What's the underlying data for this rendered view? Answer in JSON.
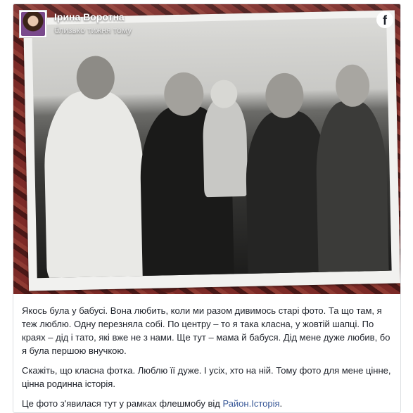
{
  "post": {
    "author": "Ірина Воротна",
    "time": "близько тижня тому",
    "icons": {
      "avatar": "avatar-photo",
      "brand": "facebook-icon"
    },
    "colors": {
      "link": "#385898",
      "text": "#1d2129",
      "border": "#dddfe2"
    },
    "paragraphs": [
      "Якось була у бабусі. Вона любить, коли ми разом дивимось старі фото. Та що там, я теж люблю. Одну перезняла собі. По центру – то я така класна, у жовтій шапці. По краях – дід і тато, які вже не з нами. Ще тут – мама й бабуся. Дід мене дуже любив, бо я була першою внучкою.",
      "Скажіть, що класна фотка. Люблю її дуже. І усіх, хто на ній. Тому фото для мене цінне, цінна родинна історія."
    ],
    "footer_prefix": "Це фото з'явилася тут у рамках флешмобу від ",
    "footer_link": "Район.Історія",
    "footer_suffix": "."
  }
}
